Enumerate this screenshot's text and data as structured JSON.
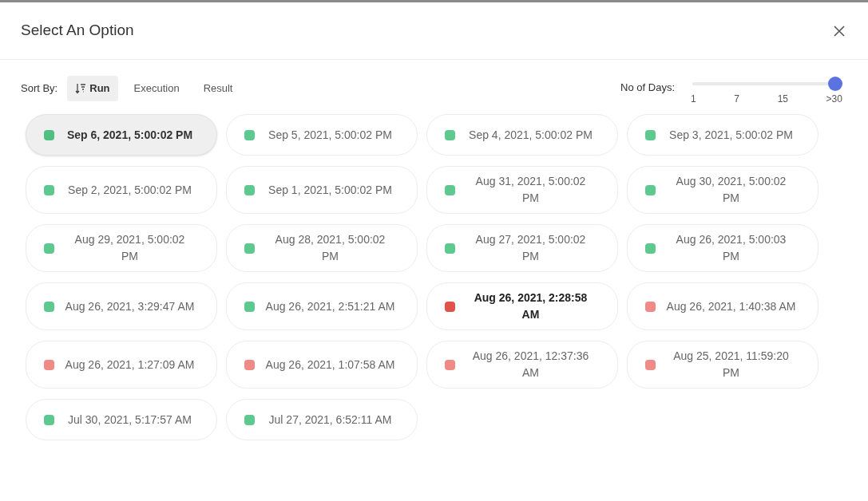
{
  "dialog": {
    "title": "Select An Option"
  },
  "sort": {
    "label": "Sort By:",
    "options": [
      {
        "label": "Run",
        "selected": true
      },
      {
        "label": "Execution",
        "selected": false
      },
      {
        "label": "Result",
        "selected": false
      }
    ]
  },
  "days": {
    "label": "No of Days:",
    "level": 1,
    "ticks": [
      "1",
      "7",
      "15",
      ">30"
    ]
  },
  "runs": [
    {
      "label": "Sep 6, 2021, 5:00:02 PM",
      "color": "#4fbf82",
      "selected": true,
      "hovered": false
    },
    {
      "label": "Sep 5, 2021, 5:00:02 PM",
      "color": "#5ec98f",
      "selected": false,
      "hovered": false
    },
    {
      "label": "Sep 4, 2021, 5:00:02 PM",
      "color": "#5ec98f",
      "selected": false,
      "hovered": false
    },
    {
      "label": "Sep 3, 2021, 5:00:02 PM",
      "color": "#5ec98f",
      "selected": false,
      "hovered": false
    },
    {
      "label": "Sep 2, 2021, 5:00:02 PM",
      "color": "#5ec98f",
      "selected": false,
      "hovered": false
    },
    {
      "label": "Sep 1, 2021, 5:00:02 PM",
      "color": "#5ec98f",
      "selected": false,
      "hovered": false
    },
    {
      "label": "Aug 31, 2021, 5:00:02 PM",
      "color": "#5ec98f",
      "selected": false,
      "hovered": false
    },
    {
      "label": "Aug 30, 2021, 5:00:02 PM",
      "color": "#5ec98f",
      "selected": false,
      "hovered": false
    },
    {
      "label": "Aug 29, 2021, 5:00:02 PM",
      "color": "#5ec98f",
      "selected": false,
      "hovered": false
    },
    {
      "label": "Aug 28, 2021, 5:00:02 PM",
      "color": "#5ec98f",
      "selected": false,
      "hovered": false
    },
    {
      "label": "Aug 27, 2021, 5:00:02 PM",
      "color": "#5ec98f",
      "selected": false,
      "hovered": false
    },
    {
      "label": "Aug 26, 2021, 5:00:03 PM",
      "color": "#5ec98f",
      "selected": false,
      "hovered": false
    },
    {
      "label": "Aug 26, 2021, 3:29:47 AM",
      "color": "#5ec98f",
      "selected": false,
      "hovered": false
    },
    {
      "label": "Aug 26, 2021, 2:51:21 AM",
      "color": "#5ec98f",
      "selected": false,
      "hovered": false
    },
    {
      "label": "Aug 26, 2021, 2:28:58 AM",
      "color": "#e0524a",
      "selected": false,
      "hovered": true
    },
    {
      "label": "Aug 26, 2021, 1:40:38 AM",
      "color": "#ef8a86",
      "selected": false,
      "hovered": false
    },
    {
      "label": "Aug 26, 2021, 1:27:09 AM",
      "color": "#ef8a86",
      "selected": false,
      "hovered": false
    },
    {
      "label": "Aug 26, 2021, 1:07:58 AM",
      "color": "#ef8a86",
      "selected": false,
      "hovered": false
    },
    {
      "label": "Aug 26, 2021, 12:37:36 AM",
      "color": "#ef8a86",
      "selected": false,
      "hovered": false
    },
    {
      "label": "Aug 25, 2021, 11:59:20 PM",
      "color": "#ef8a86",
      "selected": false,
      "hovered": false
    },
    {
      "label": "Jul 30, 2021, 5:17:57 AM",
      "color": "#5ec98f",
      "selected": false,
      "hovered": false
    },
    {
      "label": "Jul 27, 2021, 6:52:11 AM",
      "color": "#5ec98f",
      "selected": false,
      "hovered": false
    }
  ]
}
